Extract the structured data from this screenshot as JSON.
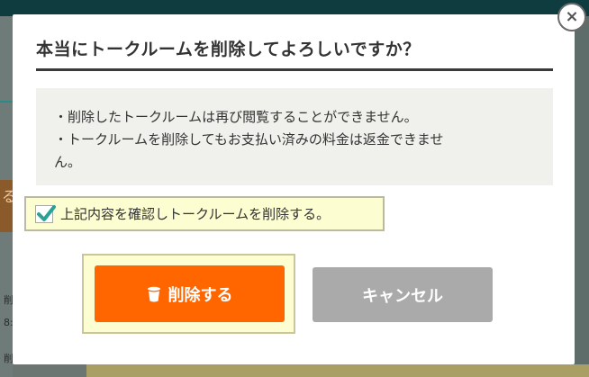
{
  "background": {
    "left_char": "る",
    "left_text_1": "削",
    "left_text_2": "8:",
    "left_text_3": "削"
  },
  "modal": {
    "title": "本当にトークルームを削除してよろしいですか？",
    "notice_lines": [
      "・削除したトークルームは再び閲覧することができません。",
      "・トークルームを削除してもお支払い済みの料金は返金できませ",
      "ん。"
    ],
    "confirm_label": "上記内容を確認しトークルームを削除する。",
    "confirm_checked": true,
    "delete_label": "削除する",
    "delete_icon": "trash-icon",
    "cancel_label": "キャンセル",
    "close_icon": "close-icon",
    "close_glyph": "×"
  },
  "colors": {
    "delete_button": "#ff6600",
    "cancel_button": "#aaaaaa",
    "highlight_bg": "#fdfdd2",
    "check_color": "#2aa198"
  }
}
